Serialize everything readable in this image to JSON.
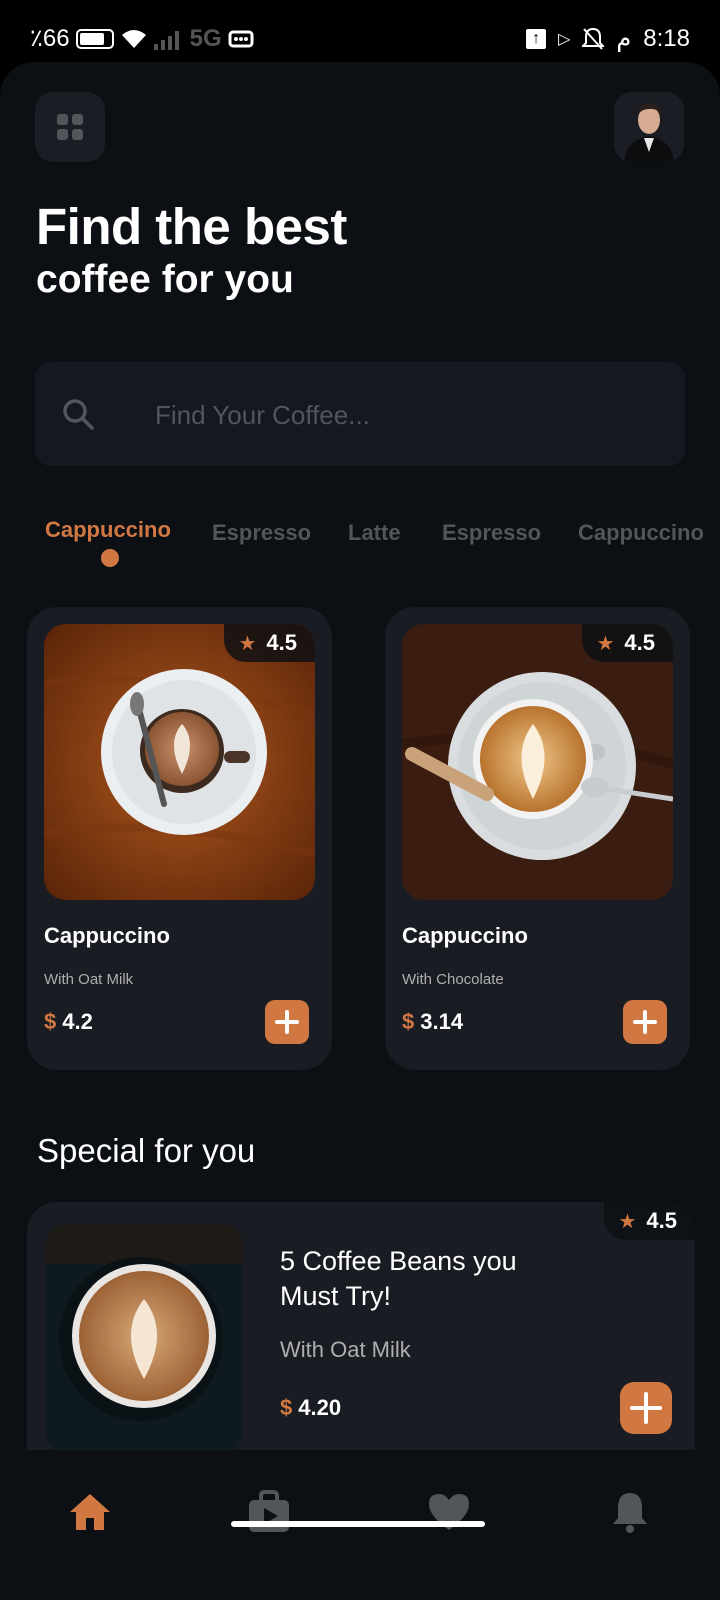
{
  "status_bar": {
    "battery_text": "٪66",
    "network": "5G",
    "time": "8:18",
    "am_pm": "م"
  },
  "header": {
    "title_line1": "Find the best",
    "title_line2": "coffee for you"
  },
  "search": {
    "placeholder": "Find Your Coffee..."
  },
  "categories": [
    {
      "label": "Cappuccino",
      "active": true
    },
    {
      "label": "Espresso",
      "active": false
    },
    {
      "label": "Latte",
      "active": false
    },
    {
      "label": "Espresso",
      "active": false
    },
    {
      "label": "Cappuccino",
      "active": false
    }
  ],
  "products": [
    {
      "name": "Cappuccino",
      "subtitle": "With Oat Milk",
      "currency": "$",
      "price": "4.2",
      "rating": "4.5"
    },
    {
      "name": "Cappuccino",
      "subtitle": "With Chocolate",
      "currency": "$",
      "price": "3.14",
      "rating": "4.5"
    }
  ],
  "special": {
    "section_title": "Special for you",
    "title": "5 Coffee Beans you\n Must Try!",
    "subtitle": "With Oat Milk",
    "currency": "$",
    "price": "4.20",
    "rating": "4.5"
  },
  "nav": {
    "items": [
      {
        "icon": "home-icon",
        "active": true
      },
      {
        "icon": "bag-icon",
        "active": false
      },
      {
        "icon": "heart-icon",
        "active": false
      },
      {
        "icon": "bell-icon",
        "active": false
      }
    ]
  },
  "colors": {
    "accent": "#d17842",
    "background": "#0c0f14",
    "card": "#191c22",
    "muted": "#52555a"
  }
}
